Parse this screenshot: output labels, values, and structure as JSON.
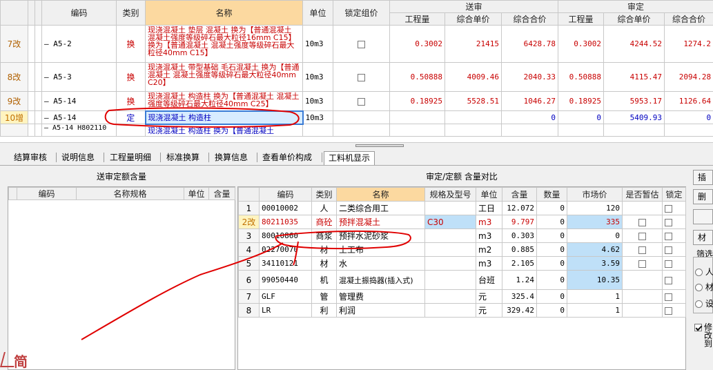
{
  "top_grid": {
    "headers": {
      "code": "编码",
      "category": "类别",
      "name": "名称",
      "unit": "单位",
      "lock": "锁定组价",
      "submitted": "送审",
      "approved": "审定",
      "quantity": "工程量",
      "unit_price": "综合单价",
      "total_price": "综合合价"
    },
    "rows": [
      {
        "num": "7改",
        "code": "A5-2",
        "category": "换",
        "name": "现浇混凝土 垫层 混凝土 换为【普通混凝土 混凝土强度等级碎石最大粒径16mm C15】 换为【普通混凝土 混凝土强度等级碎石最大粒径40mm C15】",
        "unit": "10m3",
        "sub_qty": "0.3002",
        "sub_price": "21415",
        "sub_total": "6428.78",
        "app_qty": "0.3002",
        "app_price": "4244.52",
        "app_total": "1274.2"
      },
      {
        "num": "8改",
        "code": "A5-3",
        "category": "换",
        "name": "现浇混凝土 带型基础 毛石混凝土 换为【普通混凝土 混凝土强度等级碎石最大粒径40mm C20】",
        "unit": "10m3",
        "sub_qty": "0.50888",
        "sub_price": "4009.46",
        "sub_total": "2040.33",
        "app_qty": "0.50888",
        "app_price": "4115.47",
        "app_total": "2094.28"
      },
      {
        "num": "9改",
        "code": "A5-14",
        "category": "换",
        "name": "现浇混凝土 构造柱 换为【普通混凝土 混凝土强度等级碎石最大粒径40mm C25】",
        "unit": "10m3",
        "sub_qty": "0.18925",
        "sub_price": "5528.51",
        "sub_total": "1046.27",
        "app_qty": "0.18925",
        "app_price": "5953.17",
        "app_total": "1126.64"
      },
      {
        "num": "10增",
        "code": "A5-14",
        "category": "定",
        "name": "现浇混凝土 构造柱",
        "unit": "10m3",
        "sub_qty": "",
        "sub_price": "",
        "sub_total": "0",
        "app_qty": "0",
        "app_price": "5409.93",
        "app_total": "0"
      },
      {
        "num": "",
        "code": "A5-14 H802110",
        "category": "",
        "name": "现浇混凝土 构造柱 换为【普通混凝土",
        "unit": "",
        "sub_qty": "",
        "sub_price": "",
        "sub_total": "",
        "app_qty": "",
        "app_price": "",
        "app_total": ""
      }
    ]
  },
  "tabs": [
    {
      "label": "结算审核"
    },
    {
      "label": "说明信息"
    },
    {
      "label": "工程量明细"
    },
    {
      "label": "标准换算"
    },
    {
      "label": "换算信息"
    },
    {
      "label": "查看单价构成"
    },
    {
      "label": "工料机显示"
    }
  ],
  "left_panel": {
    "caption": "送审定额含量",
    "headers": {
      "code": "编码",
      "name": "名称规格",
      "unit": "单位",
      "content": "含量"
    }
  },
  "right_panel": {
    "caption": "审定/定额 含量对比",
    "headers": {
      "code": "编码",
      "category": "类别",
      "name": "名称",
      "spec": "规格及型号",
      "unit": "单位",
      "content": "含量",
      "quantity": "数量",
      "market_price": "市场价",
      "temp": "是否暂估",
      "lock": "锁定"
    },
    "rows": [
      {
        "num": "1",
        "code": "00010002",
        "category": "人",
        "name": "二类综合用工",
        "spec": "",
        "unit": "工日",
        "content": "12.072",
        "quantity": "0",
        "market_price": "120"
      },
      {
        "num": "2改",
        "code": "80211035",
        "category": "商砼",
        "name": "预拌混凝土",
        "spec": "C30",
        "unit": "m3",
        "content": "9.797",
        "quantity": "0",
        "market_price": "335"
      },
      {
        "num": "3",
        "code": "80010860",
        "category": "商浆",
        "name": "预拌水泥砂浆",
        "spec": "",
        "unit": "m3",
        "content": "0.303",
        "quantity": "0",
        "market_price": "0"
      },
      {
        "num": "4",
        "code": "02270070",
        "category": "材",
        "name": "土工布",
        "spec": "",
        "unit": "m2",
        "content": "0.885",
        "quantity": "0",
        "market_price": "4.62"
      },
      {
        "num": "5",
        "code": "34110121",
        "category": "材",
        "name": "水",
        "spec": "",
        "unit": "m3",
        "content": "2.105",
        "quantity": "0",
        "market_price": "3.59"
      },
      {
        "num": "6",
        "code": "99050440",
        "category": "机",
        "name": "混凝土振捣器(插入式)",
        "spec": "",
        "unit": "台班",
        "content": "1.24",
        "quantity": "0",
        "market_price": "10.35"
      },
      {
        "num": "7",
        "code": "GLF",
        "category": "管",
        "name": "管理费",
        "spec": "",
        "unit": "元",
        "content": "325.4",
        "quantity": "0",
        "market_price": "1"
      },
      {
        "num": "8",
        "code": "LR",
        "category": "利",
        "name": "利润",
        "spec": "",
        "unit": "元",
        "content": "329.42",
        "quantity": "0",
        "market_price": "1"
      }
    ]
  },
  "side": {
    "insert_label": "插入",
    "delete_label": "删除",
    "material_label": "材",
    "filter_label": "筛选",
    "radio_person": "人",
    "radio_material": "材",
    "radio_equipment": "设",
    "modify_label": "修改到"
  },
  "logo_text": "简"
}
